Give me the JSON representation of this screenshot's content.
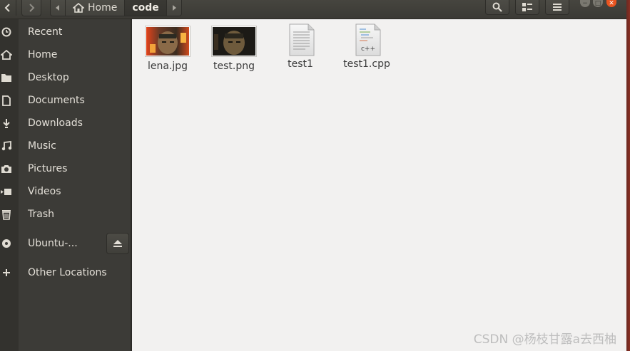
{
  "header": {
    "breadcrumbs": [
      {
        "label": "Home",
        "icon": "home-icon"
      },
      {
        "label": "code",
        "icon": ""
      }
    ]
  },
  "sidebar": {
    "items": [
      {
        "label": "Recent",
        "icon": "clock-icon"
      },
      {
        "label": "Home",
        "icon": "home-icon"
      },
      {
        "label": "Desktop",
        "icon": "folder-icon"
      },
      {
        "label": "Documents",
        "icon": "document-icon"
      },
      {
        "label": "Downloads",
        "icon": "download-icon"
      },
      {
        "label": "Music",
        "icon": "music-icon"
      },
      {
        "label": "Pictures",
        "icon": "camera-icon"
      },
      {
        "label": "Videos",
        "icon": "video-icon"
      },
      {
        "label": "Trash",
        "icon": "trash-icon"
      }
    ],
    "devices": [
      {
        "label": "Ubuntu-...",
        "icon": "disc-icon"
      }
    ],
    "other": {
      "label": "Other Locations",
      "icon": "plus-icon"
    }
  },
  "files": [
    {
      "name": "lena.jpg",
      "type": "image"
    },
    {
      "name": "test.png",
      "type": "image"
    },
    {
      "name": "test1",
      "type": "text"
    },
    {
      "name": "test1.cpp",
      "type": "cpp",
      "badge": "c++"
    }
  ],
  "watermark": "CSDN @杨枝甘露a去西柚",
  "colors": {
    "sidebar": "#3c3b37",
    "header": "#3b3a35",
    "content": "#f2f1f0",
    "close_button": "#e95420"
  }
}
